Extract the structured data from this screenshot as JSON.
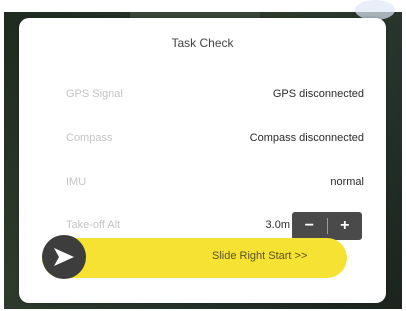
{
  "dialog": {
    "title": "Task Check",
    "rows": [
      {
        "label": "GPS Signal",
        "value": "GPS disconnected"
      },
      {
        "label": "Compass",
        "value": "Compass disconnected"
      },
      {
        "label": "IMU",
        "value": "normal"
      },
      {
        "label": "Take-off Alt",
        "value": "3.0m"
      }
    ],
    "stepper": {
      "minus_label": "−",
      "plus_label": "+"
    },
    "slider": {
      "label": "Slide Right Start >>",
      "knob_icon": "arrow-right-icon"
    }
  },
  "colors": {
    "slider_fill": "#f5e233",
    "knob": "#3d3d3d",
    "stepper": "#4a4a4a"
  }
}
